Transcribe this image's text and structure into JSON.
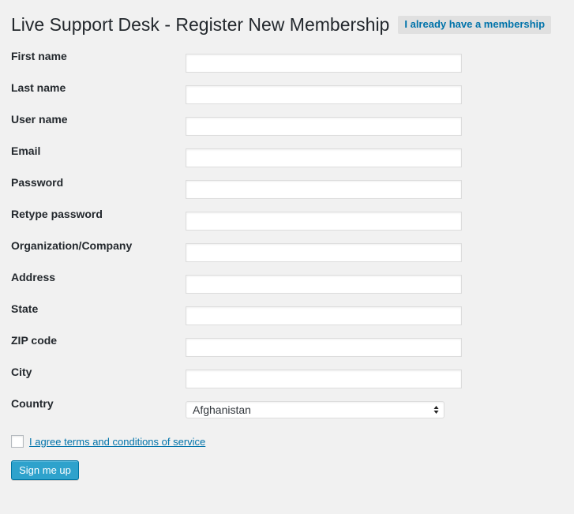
{
  "header": {
    "title": "Live Support Desk - Register New Membership",
    "action_label": "I already have a membership"
  },
  "fields": [
    {
      "label": "First name",
      "value": ""
    },
    {
      "label": "Last name",
      "value": ""
    },
    {
      "label": "User name",
      "value": ""
    },
    {
      "label": "Email",
      "value": ""
    },
    {
      "label": "Password",
      "value": ""
    },
    {
      "label": "Retype password",
      "value": ""
    },
    {
      "label": "Organization/Company",
      "value": ""
    },
    {
      "label": "Address",
      "value": ""
    },
    {
      "label": "State",
      "value": ""
    },
    {
      "label": "ZIP code",
      "value": ""
    },
    {
      "label": "City",
      "value": ""
    }
  ],
  "country": {
    "label": "Country",
    "selected": "Afghanistan"
  },
  "terms": {
    "label": "I agree terms and conditions of service",
    "checked": false
  },
  "submit": {
    "label": "Sign me up"
  },
  "colors": {
    "background": "#f1f1f1",
    "link": "#0073aa",
    "button": "#2ea2cc",
    "button_border": "#0074a2"
  }
}
